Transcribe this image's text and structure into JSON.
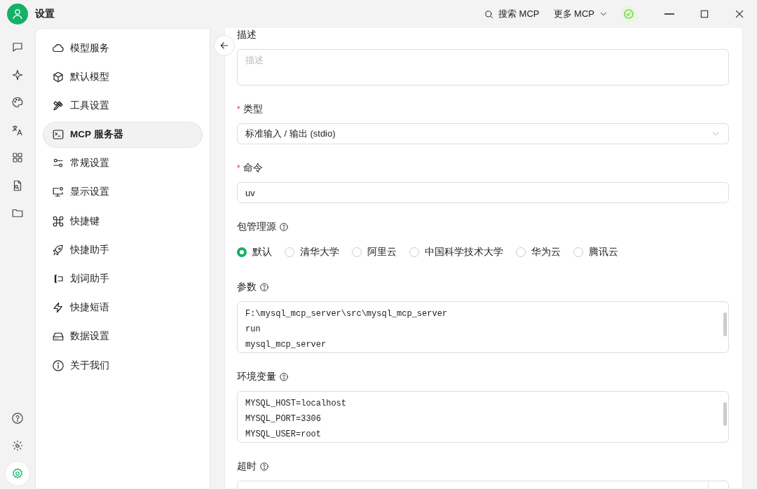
{
  "window": {
    "title": "设置"
  },
  "toolbar": {
    "search_label": "搜索 MCP",
    "more_label": "更多 MCP",
    "status_ok": true
  },
  "rail": {
    "top": [
      {
        "selected": false
      },
      {
        "selected": false
      },
      {
        "selected": false
      },
      {
        "selected": false
      },
      {
        "selected": false
      },
      {
        "selected": false
      },
      {
        "selected": false
      }
    ],
    "bottom": [
      {
        "selected": false
      },
      {
        "selected": false
      },
      {
        "selected": true
      }
    ]
  },
  "sidebar": {
    "items": [
      {
        "label": "模型服务",
        "selected": false
      },
      {
        "label": "默认模型",
        "selected": false
      },
      {
        "label": "工具设置",
        "selected": false
      },
      {
        "label": "MCP 服务器",
        "selected": true
      },
      {
        "label": "常规设置",
        "selected": false
      },
      {
        "label": "显示设置",
        "selected": false
      },
      {
        "label": "快捷键",
        "selected": false
      },
      {
        "label": "快捷助手",
        "selected": false
      },
      {
        "label": "划词助手",
        "selected": false
      },
      {
        "label": "快捷短语",
        "selected": false
      },
      {
        "label": "数据设置",
        "selected": false
      },
      {
        "label": "关于我们",
        "selected": false
      }
    ]
  },
  "form": {
    "fields": [
      {
        "kind": "textarea",
        "label": "描述",
        "help": false,
        "placeholder": "描述"
      },
      {
        "kind": "select",
        "label": "类型",
        "required_mark": "*",
        "help": false,
        "value": "标准输入 / 输出 (stdio)"
      },
      {
        "kind": "input",
        "label": "命令",
        "required_mark": "*",
        "help": false,
        "value": "uv"
      },
      {
        "kind": "radio",
        "label": "包管理源",
        "help": true,
        "options": [
          {
            "label": "默认",
            "selected": true
          },
          {
            "label": "清华大学",
            "selected": false
          },
          {
            "label": "阿里云",
            "selected": false
          },
          {
            "label": "中国科学技术大学",
            "selected": false
          },
          {
            "label": "华为云",
            "selected": false
          },
          {
            "label": "腾讯云",
            "selected": false
          }
        ]
      },
      {
        "kind": "code",
        "label": "参数",
        "help": true,
        "lines": [
          "F:\\mysql_mcp_server\\src\\mysql_mcp_server",
          "run",
          "mysql_mcp_server"
        ]
      },
      {
        "kind": "code",
        "label": "环境变量",
        "help": true,
        "lines": [
          "MYSQL_HOST=localhost",
          "MYSQL_PORT=3306",
          "MYSQL_USER=root"
        ]
      },
      {
        "kind": "number",
        "label": "超时",
        "help": true
      }
    ]
  }
}
